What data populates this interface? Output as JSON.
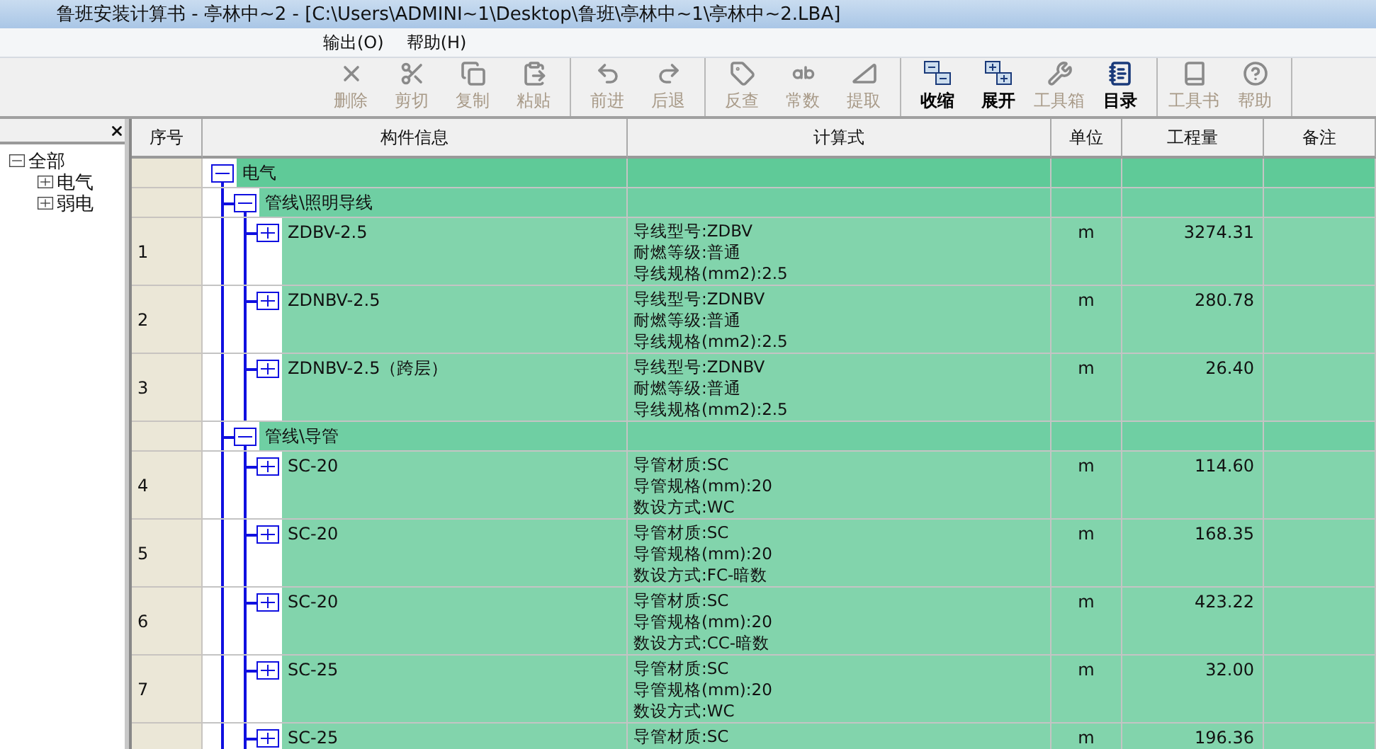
{
  "window": {
    "title": "鲁班安装计算书 - 亭林中~2 - [C:\\Users\\ADMINI~1\\Desktop\\鲁班\\亭林中~1\\亭林中~2.LBA]"
  },
  "menu": [
    {
      "label": "输出(O)"
    },
    {
      "label": "帮助(H)"
    }
  ],
  "toolbar": {
    "groups": [
      [
        {
          "label": "删除",
          "disabled": true
        },
        {
          "label": "剪切",
          "disabled": true
        },
        {
          "label": "复制",
          "disabled": true
        },
        {
          "label": "粘贴",
          "disabled": true
        }
      ],
      [
        {
          "label": "前进",
          "disabled": true
        },
        {
          "label": "后退",
          "disabled": true
        }
      ],
      [
        {
          "label": "反查",
          "disabled": true
        },
        {
          "label": "常数",
          "disabled": true
        },
        {
          "label": "提取",
          "disabled": true
        }
      ],
      [
        {
          "label": "收缩",
          "disabled": false
        },
        {
          "label": "展开",
          "disabled": false
        },
        {
          "label": "工具箱",
          "disabled": true
        },
        {
          "label": "目录",
          "disabled": false
        }
      ],
      [
        {
          "label": "工具书",
          "disabled": true
        },
        {
          "label": "帮助",
          "disabled": true
        }
      ]
    ]
  },
  "sidebar": {
    "tree": [
      {
        "label": "全部",
        "expanded": true,
        "children": [
          {
            "label": "电气",
            "expanded": false
          },
          {
            "label": "弱电",
            "expanded": false
          }
        ]
      }
    ]
  },
  "table": {
    "columns": [
      "序号",
      "构件信息",
      "计算式",
      "单位",
      "工程量",
      "备注"
    ],
    "rows": [
      {
        "kind": "group",
        "label": "电气",
        "expanded": true,
        "children": [
          {
            "kind": "group",
            "label": "管线\\照明导线",
            "expanded": true,
            "children": [
              {
                "kind": "item",
                "index": "1",
                "label": "ZDBV-2.5",
                "expanded": false,
                "formula": [
                  "导线型号:ZDBV",
                  "耐燃等级:普通",
                  "导线规格(mm2):2.5"
                ],
                "unit": "m",
                "quantity": "3274.31"
              },
              {
                "kind": "item",
                "index": "2",
                "label": "ZDNBV-2.5",
                "expanded": false,
                "formula": [
                  "导线型号:ZDNBV",
                  "耐燃等级:普通",
                  "导线规格(mm2):2.5"
                ],
                "unit": "m",
                "quantity": "280.78"
              },
              {
                "kind": "item",
                "index": "3",
                "label": "ZDNBV-2.5（跨层）",
                "expanded": false,
                "formula": [
                  "导线型号:ZDNBV",
                  "耐燃等级:普通",
                  "导线规格(mm2):2.5"
                ],
                "unit": "m",
                "quantity": "26.40"
              }
            ]
          },
          {
            "kind": "group",
            "label": "管线\\导管",
            "expanded": true,
            "children": [
              {
                "kind": "item",
                "index": "4",
                "label": "SC-20",
                "expanded": false,
                "formula": [
                  "导管材质:SC",
                  "导管规格(mm):20",
                  "数设方式:WC"
                ],
                "unit": "m",
                "quantity": "114.60"
              },
              {
                "kind": "item",
                "index": "5",
                "label": "SC-20",
                "expanded": false,
                "formula": [
                  "导管材质:SC",
                  "导管规格(mm):20",
                  "数设方式:FC-暗数"
                ],
                "unit": "m",
                "quantity": "168.35"
              },
              {
                "kind": "item",
                "index": "6",
                "label": "SC-20",
                "expanded": false,
                "formula": [
                  "导管材质:SC",
                  "导管规格(mm):20",
                  "数设方式:CC-暗数"
                ],
                "unit": "m",
                "quantity": "423.22"
              },
              {
                "kind": "item",
                "index": "7",
                "label": "SC-25",
                "expanded": false,
                "formula": [
                  "导管材质:SC",
                  "导管规格(mm):20",
                  "数设方式:WC"
                ],
                "unit": "m",
                "quantity": "32.00"
              },
              {
                "kind": "item",
                "label": "SC-25",
                "expanded": false,
                "formula": [
                  "导管材质:SC"
                ],
                "unit": "m",
                "quantity": "196.36"
              }
            ]
          }
        ]
      }
    ]
  }
}
